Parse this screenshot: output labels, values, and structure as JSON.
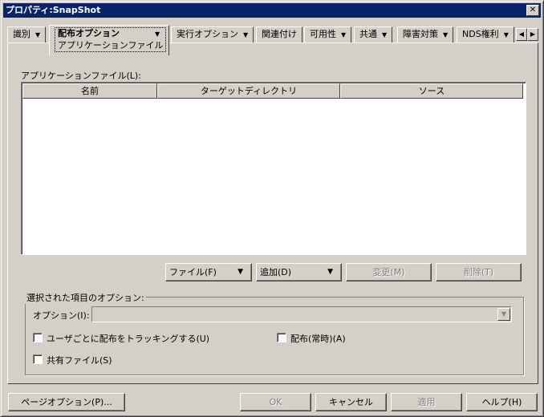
{
  "window": {
    "title": "プロパティ:SnapShot"
  },
  "tabs": [
    {
      "label": "識別"
    },
    {
      "label": "配布オプション",
      "sublabel": "アプリケーションファイル"
    },
    {
      "label": "実行オプション"
    },
    {
      "label": "関連付け"
    },
    {
      "label": "可用性"
    },
    {
      "label": "共通"
    },
    {
      "label": "障害対策"
    },
    {
      "label": "NDS権利"
    }
  ],
  "app_files": {
    "label": "アプリケーションファイル(L):",
    "columns": [
      "名前",
      "ターゲットディレクトリ",
      "ソース"
    ],
    "rows": []
  },
  "list_buttons": {
    "file": "ファイル(F)",
    "add": "追加(D)",
    "change": "変更(M)",
    "delete": "削除(T)"
  },
  "options_group": {
    "title": "選択された項目のオプション:",
    "option_label": "オプション(I):",
    "option_value": "",
    "track_per_user": "ユーザごとに配布をトラッキングする(U)",
    "distribute_always": "配布(常時)(A)",
    "shared_file": "共有ファイル(S)"
  },
  "footer": {
    "page_options": "ページオプション(P)...",
    "ok": "OK",
    "cancel": "キャンセル",
    "apply": "適用",
    "help": "ヘルプ(H)"
  },
  "colors": {
    "titlebar": "#0a246a",
    "face": "#d4d0c8"
  }
}
